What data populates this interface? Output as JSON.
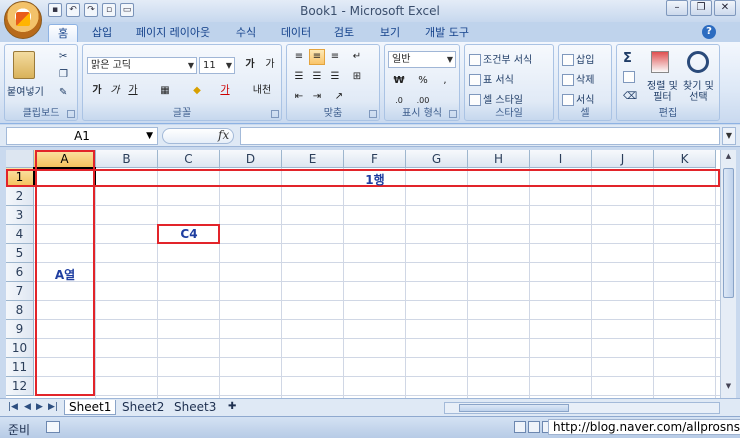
{
  "window": {
    "title": "Book1 - Microsoft Excel"
  },
  "tabs": [
    {
      "label": "홈",
      "active": true
    },
    {
      "label": "삽입"
    },
    {
      "label": "페이지 레이아웃"
    },
    {
      "label": "수식"
    },
    {
      "label": "데이터"
    },
    {
      "label": "검토"
    },
    {
      "label": "보기"
    },
    {
      "label": "개발 도구"
    }
  ],
  "ribbon": {
    "clipboard": {
      "paste": "붙여넣기",
      "label": "클립보드"
    },
    "font": {
      "name": "맑은 고딕",
      "size": "11",
      "label": "글꼴"
    },
    "alignment": {
      "label": "맞춤"
    },
    "number": {
      "format": "일반",
      "currency": "₩",
      "percent": "%",
      "comma": ",",
      "label": "표시 형식"
    },
    "styles": {
      "conditional": "조건부 서식",
      "table": "표 서식",
      "cell": "셀 스타일",
      "label": "스타일"
    },
    "cells": {
      "insert": "삽입",
      "delete": "삭제",
      "format": "서식",
      "label": "셀"
    },
    "editing": {
      "sum": "Σ",
      "sort_line1": "정렬 및",
      "sort_line2": "필터",
      "find_line1": "찾기 및",
      "find_line2": "선택",
      "label": "편집"
    }
  },
  "formula_bar": {
    "name_box": "A1",
    "fx": "fx",
    "value": ""
  },
  "grid": {
    "columns": [
      "A",
      "B",
      "C",
      "D",
      "E",
      "F",
      "G",
      "H",
      "I",
      "J",
      "K"
    ],
    "rows": [
      "1",
      "2",
      "3",
      "4",
      "5",
      "6",
      "7",
      "8",
      "9",
      "10",
      "11",
      "12"
    ],
    "selected_cell": "A1"
  },
  "annotations": {
    "row": "1행",
    "cell": "C4",
    "column": "A열"
  },
  "sheets": [
    "Sheet1",
    "Sheet2",
    "Sheet3"
  ],
  "status": {
    "text": "준비"
  },
  "watermark": "http://blog.naver.com/allprosns",
  "colors": {
    "annotation_box": "#e2242a",
    "annotation_text": "#1f3ea0",
    "ribbon": "#dde8f6"
  }
}
